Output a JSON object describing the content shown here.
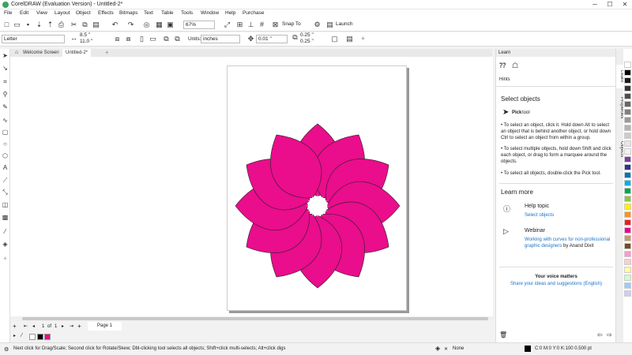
{
  "app": {
    "title": "CorelDRAW (Evaluation Version) - Untitled-2*"
  },
  "window_controls": {
    "minimize": "─",
    "maximize": "☐",
    "close": "✕"
  },
  "menu": [
    "File",
    "Edit",
    "View",
    "Layout",
    "Object",
    "Effects",
    "Bitmaps",
    "Text",
    "Table",
    "Tools",
    "Window",
    "Help",
    "Purchase"
  ],
  "std_toolbar": {
    "zoom": "67%",
    "snap_to": "Snap To",
    "launch": "Launch"
  },
  "property_bar": {
    "page_size": "Letter",
    "width": "8.5 \"",
    "height": "11.0 \"",
    "units_label": "Units:",
    "units_value": "inches",
    "nudge": "0.01 \"",
    "dup_x": "0.25 \"",
    "dup_y": "0.25 \""
  },
  "tabs": [
    {
      "label": "Welcome Screen"
    },
    {
      "label": "Untitled-2*"
    }
  ],
  "page_nav": {
    "current": "1",
    "of": "of",
    "total": "1",
    "page_tab": "Page 1"
  },
  "learn_panel": {
    "header": "Learn",
    "hints": "Hints",
    "section_title": "Select objects",
    "tool_name": "Pick",
    "tool_suffix": "tool",
    "bullets": [
      "To select an object, click it. Hold down Alt to select an object that is behind another object, or hold down Ctrl to select an object from within a group.",
      "To select multiple objects, hold down Shift and click each object, or drag to form a marquee around the objects.",
      "To select all objects, double-click the Pick tool."
    ],
    "learn_more": "Learn more",
    "help_topic": "Help topic",
    "help_link": "Select objects",
    "webinar": "Webinar",
    "webinar_link": "Working with curves for non-professional graphic designers",
    "webinar_by": "by",
    "webinar_author": "Anand Dixit",
    "voice_title": "Your voice matters",
    "voice_link": "Share your ideas and suggestions (English)"
  },
  "side_tabs": [
    "Learn",
    "Properties",
    "Objects"
  ],
  "palette_colors": [
    "#ffffff",
    "#000000",
    "#1a1a1a",
    "#333333",
    "#4d4d4d",
    "#666666",
    "#808080",
    "#999999",
    "#b3b3b3",
    "#cccccc",
    "#e6e6e6",
    "#f2f2f2",
    "#7a3e9d",
    "#2e3192",
    "#0072bc",
    "#00aeef",
    "#00a651",
    "#8dc63f",
    "#fff200",
    "#f7941d",
    "#ed1c24",
    "#ec008c",
    "#c69c6d",
    "#754c24",
    "#f9c",
    "#fcc",
    "#ff9",
    "#cfc",
    "#9cf",
    "#ccf"
  ],
  "flower": {
    "fill": "#ea0d8c"
  },
  "status": {
    "message": "Next click for Drag/Scale; Second click for Rotate/Skew; Dbl-clicking tool selects all objects; Shift+click multi-selects; Alt+click digs",
    "fill_none": "None",
    "color_info": "C:0 M:0 Y:0 K:100  0.500 pt"
  },
  "doc_colors": {
    "outline": "#000000",
    "fill": "#ea0d8c"
  }
}
